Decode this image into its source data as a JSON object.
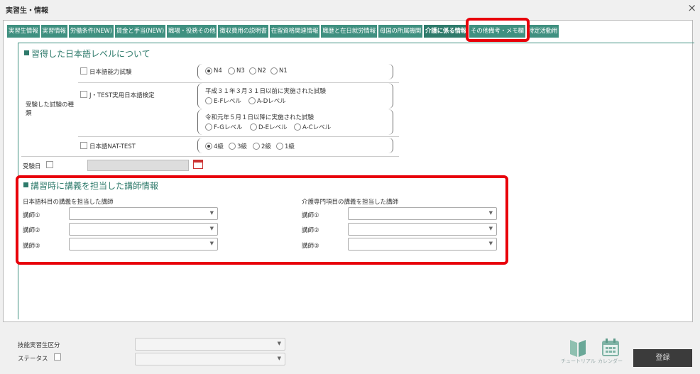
{
  "window": {
    "title": "実習生・情報",
    "close": "×"
  },
  "tabs": [
    {
      "label": "実習生情報"
    },
    {
      "label": "実習情報"
    },
    {
      "label": "労働条件(NEW)"
    },
    {
      "label": "賃金と手当(NEW)"
    },
    {
      "label": "職場・役務その他"
    },
    {
      "label": "徴収費用の説明書"
    },
    {
      "label": "在留資格関連情報"
    },
    {
      "label": "職歴と在日就労情報"
    },
    {
      "label": "母国の所属機関"
    },
    {
      "label": "介護に係る情報",
      "active": true
    },
    {
      "label": "その他備考・メモ欄"
    },
    {
      "label": "特定活動用"
    }
  ],
  "japanese_level": {
    "title": "習得した日本語レベルについて",
    "exam_type_label": "受験した試験の種類",
    "jlpt": {
      "label": "日本語能力試験",
      "options": [
        "N4",
        "N3",
        "N2",
        "N1"
      ],
      "selected": "N4"
    },
    "jtest": {
      "label": "J・TEST実用日本語検定",
      "before_note": "平成３１年３月３１日以前に実施された試験",
      "before_options": [
        "E-Fレベル",
        "A-Dレベル"
      ],
      "after_note": "令和元年５月１日以降に実施された試験",
      "after_options": [
        "F-Gレベル",
        "D-Eレベル",
        "A-Cレベル"
      ]
    },
    "nat": {
      "label": "日本語NAT-TEST",
      "options": [
        "4級",
        "3級",
        "2級",
        "1級"
      ],
      "selected": "4級"
    },
    "exam_date_label": "受験日"
  },
  "instructors": {
    "title": "講習時に講義を担当した講師情報",
    "japanese_col_title": "日本語科目の講義を担当した講師",
    "care_col_title": "介護専門項目の講義を担当した講師",
    "rows": [
      "講師①",
      "講師②",
      "講師③"
    ]
  },
  "footer": {
    "skill_label": "技能実習生区分",
    "status_label": "ステータス",
    "tutorial_label": "チュートリアル",
    "calendar_label": "カレンダー",
    "register_label": "登録"
  },
  "colors": {
    "accent": "#3f9080",
    "highlight": "#e8000a"
  }
}
